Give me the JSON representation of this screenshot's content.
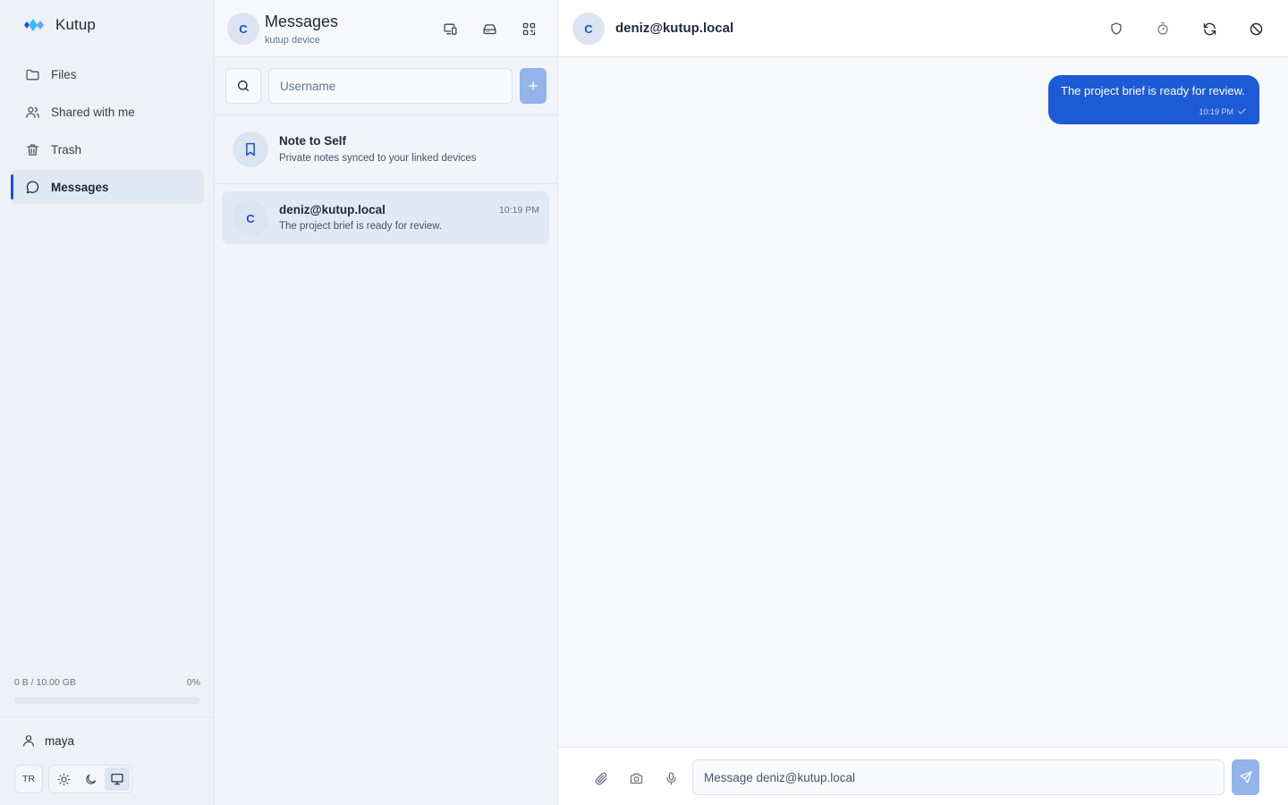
{
  "app": {
    "name": "Kutup",
    "logo_icon": "kutup-logo-icon"
  },
  "sidebar": {
    "items": [
      {
        "label": "Files",
        "icon": "folder-icon",
        "active": false
      },
      {
        "label": "Shared with me",
        "icon": "users-icon",
        "active": false
      },
      {
        "label": "Trash",
        "icon": "trash-icon",
        "active": false
      },
      {
        "label": "Messages",
        "icon": "message-circle-icon",
        "active": true
      }
    ],
    "storage": {
      "used_label": "0 B / 10.00 GB",
      "percent_label": "0%",
      "percent": 0
    },
    "user": {
      "name": "maya",
      "icon": "user-icon"
    },
    "language_label": "TR",
    "theme_options": [
      "sun-icon",
      "moon-icon",
      "monitor-icon"
    ],
    "theme_active": "monitor-icon"
  },
  "messages_panel": {
    "avatar_letter": "C",
    "title": "Messages",
    "subtitle": "kutup device",
    "header_icons": [
      "devices-icon",
      "drive-icon",
      "qr-code-icon"
    ],
    "search": {
      "placeholder": "Username",
      "value": ""
    },
    "note_to_self": {
      "title": "Note to Self",
      "subtitle": "Private notes synced to your linked devices",
      "icon": "bookmark-icon"
    },
    "conversations": [
      {
        "avatar_letter": "C",
        "name": "deniz@kutup.local",
        "preview": "The project brief is ready for review.",
        "time": "10:19 PM",
        "selected": true
      }
    ]
  },
  "chat": {
    "avatar_letter": "C",
    "title": "deniz@kutup.local",
    "header_icons": [
      "shield-icon",
      "timer-icon",
      "refresh-icon",
      "block-icon"
    ],
    "messages": [
      {
        "text": "The project brief is ready for review.",
        "time": "10:19 PM",
        "outgoing": true,
        "status_icon": "check-icon"
      }
    ],
    "composer": {
      "placeholder": "Message deniz@kutup.local",
      "value": "",
      "icons": [
        "paperclip-icon",
        "camera-icon",
        "mic-icon",
        "send-icon"
      ]
    }
  },
  "colors": {
    "accent": "#1d4ed8",
    "bubble": "#1d5bd6",
    "button_disabled": "#93b4ea",
    "sidebar_bg": "#eef2f7",
    "avatar_bg": "#dbe5f2"
  }
}
